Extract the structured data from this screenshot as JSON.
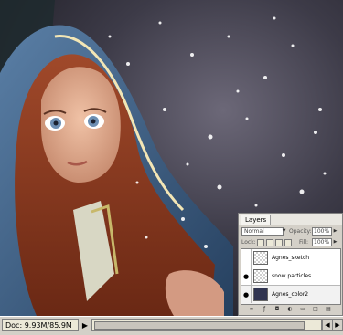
{
  "status_bar": {
    "doc_size": "Doc: 9.93M/85.9M",
    "nav_arrow": "▶",
    "scroll_left": "◀",
    "scroll_right": "▶"
  },
  "layers_panel": {
    "tab_title": "Layers",
    "blend_mode": "Normal",
    "opacity_label": "Opacity:",
    "opacity_value": "100%",
    "lock_label": "Lock:",
    "fill_label": "Fill:",
    "fill_value": "100%",
    "layers": [
      {
        "name": "Agnes_sketch",
        "visible": false,
        "thumbnail": "transparent"
      },
      {
        "name": "snow particles",
        "visible": true,
        "thumbnail": "transparent"
      },
      {
        "name": "Agnes_color2",
        "visible": true,
        "thumbnail": "painting"
      }
    ],
    "footer_icons": [
      "link-icon",
      "fx-icon",
      "mask-icon",
      "adjustment-icon",
      "folder-icon",
      "new-layer-icon",
      "trash-icon"
    ]
  },
  "colors": {
    "hood_blue": "#3b5f8c",
    "hair": "#8a3a1e",
    "skin": "#d9a48a",
    "background": "#3a3844",
    "panel_gray": "#d4d0c8"
  }
}
